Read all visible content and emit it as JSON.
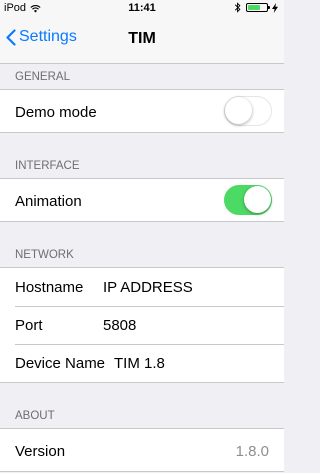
{
  "status_bar": {
    "device": "iPod",
    "time": "11:41"
  },
  "nav": {
    "back_label": "Settings",
    "title": "TIM"
  },
  "sections": {
    "general": {
      "header": "GENERAL",
      "demo_mode": {
        "label": "Demo mode",
        "enabled": false
      }
    },
    "interface": {
      "header": "INTERFACE",
      "animation": {
        "label": "Animation",
        "enabled": true
      }
    },
    "network": {
      "header": "NETWORK",
      "hostname": {
        "label": "Hostname",
        "value": "IP ADDRESS"
      },
      "port": {
        "label": "Port",
        "value": "5808"
      },
      "device_name": {
        "label": "Device Name",
        "value": "TIM 1.8"
      }
    },
    "about": {
      "header": "ABOUT",
      "version": {
        "label": "Version",
        "value": "1.8.0"
      }
    }
  },
  "colors": {
    "accent": "#0a7aff",
    "toggle_on": "#4cd964",
    "background": "#efeff4"
  },
  "icons": [
    "wifi-icon",
    "bluetooth-icon",
    "battery-icon",
    "charging-bolt-icon",
    "chevron-left-icon"
  ]
}
